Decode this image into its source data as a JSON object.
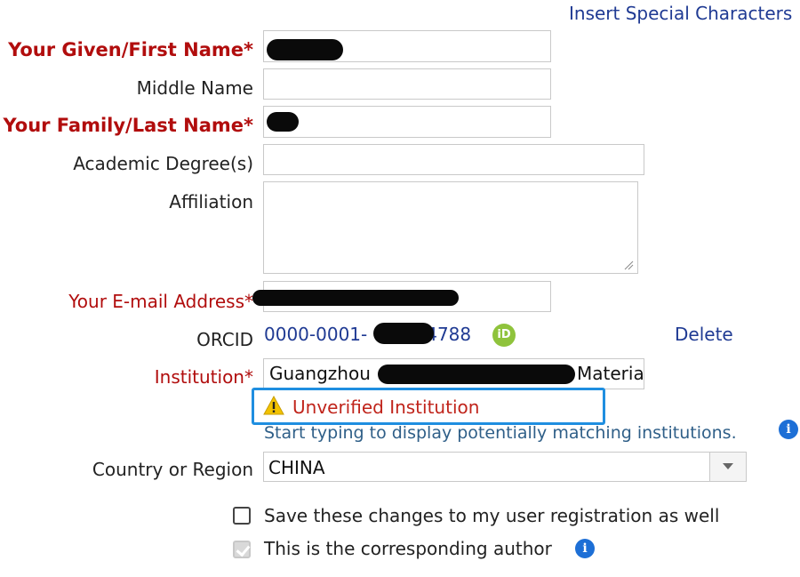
{
  "header": {
    "insert_special_chars": "Insert Special Characters"
  },
  "form": {
    "given_name": {
      "label": "Your Given/First Name*",
      "value": ""
    },
    "middle_name": {
      "label": "Middle Name",
      "value": ""
    },
    "family_name": {
      "label": "Your Family/Last Name*",
      "value": ""
    },
    "academic_degree": {
      "label": "Academic Degree(s)",
      "value": ""
    },
    "affiliation": {
      "label": "Affiliation",
      "value": ""
    },
    "email": {
      "label": "Your E-mail Address*",
      "value": ""
    },
    "orcid": {
      "label": "ORCID",
      "value_prefix": "0000-0001-",
      "value_suffix": "4788",
      "badge": "iD",
      "delete_label": "Delete"
    },
    "institution": {
      "label": "Institution*",
      "value_start": "Guangzhou",
      "value_end": "Materia",
      "status": "Unverified Institution",
      "hint": "Start typing to display potentially matching institutions."
    },
    "country": {
      "label": "Country or Region",
      "selected": "CHINA"
    },
    "save_changes": {
      "label": "Save these changes to my user registration as well",
      "checked": false
    },
    "corresponding_author": {
      "label": "This is the corresponding author",
      "checked": true,
      "disabled": true
    }
  },
  "colors": {
    "required_label": "#b10d0d",
    "link": "#1f3a93",
    "warning_text": "#c0241b",
    "highlight_border": "#1f8ee0",
    "orcid_green": "#8fc33c",
    "info_blue": "#1d6fd6"
  },
  "icons": {
    "orcid": "orcid-icon",
    "warning": "warning-icon",
    "info": "info-icon",
    "dropdown": "chevron-down-icon",
    "resize": "resize-handle-icon"
  }
}
